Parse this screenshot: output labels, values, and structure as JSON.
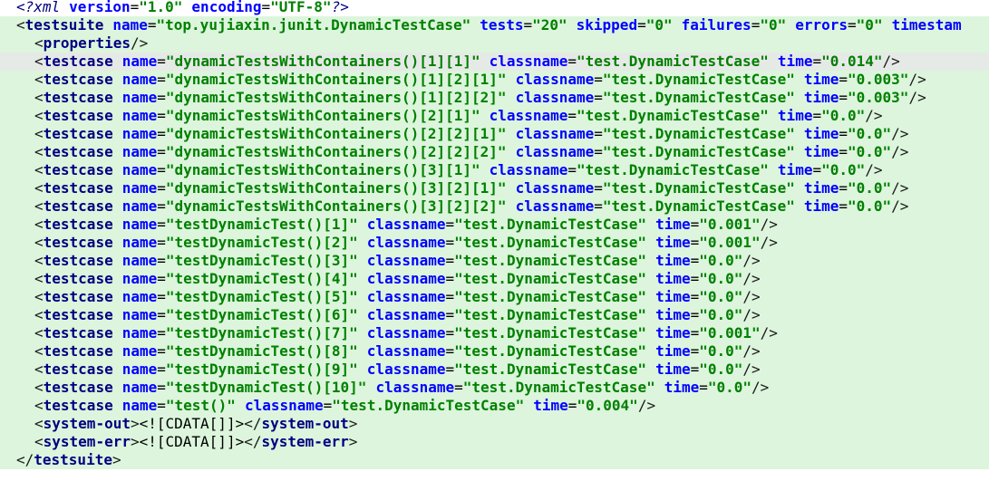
{
  "prolog": {
    "target": "xml",
    "version_attr": "version",
    "version_val": "\"1.0\"",
    "encoding_attr": "encoding",
    "encoding_val": "\"UTF-8\""
  },
  "suite": {
    "tag": "testsuite",
    "attrs": [
      {
        "name": "name",
        "value": "\"top.yujiaxin.junit.DynamicTestCase\""
      },
      {
        "name": "tests",
        "value": "\"20\""
      },
      {
        "name": "skipped",
        "value": "\"0\""
      },
      {
        "name": "failures",
        "value": "\"0\""
      },
      {
        "name": "errors",
        "value": "\"0\""
      },
      {
        "name": "timestam",
        "value": ""
      }
    ]
  },
  "properties_tag": "properties",
  "testcase_tag": "testcase",
  "attr_labels": {
    "name": "name",
    "classname": "classname",
    "time": "time"
  },
  "testcases": [
    {
      "name": "\"dynamicTestsWithContainers()[1][1]\"",
      "classname": "\"test.DynamicTestCase\"",
      "time": "\"0.014\""
    },
    {
      "name": "\"dynamicTestsWithContainers()[1][2][1]\"",
      "classname": "\"test.DynamicTestCase\"",
      "time": "\"0.003\""
    },
    {
      "name": "\"dynamicTestsWithContainers()[1][2][2]\"",
      "classname": "\"test.DynamicTestCase\"",
      "time": "\"0.003\""
    },
    {
      "name": "\"dynamicTestsWithContainers()[2][1]\"",
      "classname": "\"test.DynamicTestCase\"",
      "time": "\"0.0\""
    },
    {
      "name": "\"dynamicTestsWithContainers()[2][2][1]\"",
      "classname": "\"test.DynamicTestCase\"",
      "time": "\"0.0\""
    },
    {
      "name": "\"dynamicTestsWithContainers()[2][2][2]\"",
      "classname": "\"test.DynamicTestCase\"",
      "time": "\"0.0\""
    },
    {
      "name": "\"dynamicTestsWithContainers()[3][1]\"",
      "classname": "\"test.DynamicTestCase\"",
      "time": "\"0.0\""
    },
    {
      "name": "\"dynamicTestsWithContainers()[3][2][1]\"",
      "classname": "\"test.DynamicTestCase\"",
      "time": "\"0.0\""
    },
    {
      "name": "\"dynamicTestsWithContainers()[3][2][2]\"",
      "classname": "\"test.DynamicTestCase\"",
      "time": "\"0.0\""
    },
    {
      "name": "\"testDynamicTest()[1]\"",
      "classname": "\"test.DynamicTestCase\"",
      "time": "\"0.001\""
    },
    {
      "name": "\"testDynamicTest()[2]\"",
      "classname": "\"test.DynamicTestCase\"",
      "time": "\"0.001\""
    },
    {
      "name": "\"testDynamicTest()[3]\"",
      "classname": "\"test.DynamicTestCase\"",
      "time": "\"0.0\""
    },
    {
      "name": "\"testDynamicTest()[4]\"",
      "classname": "\"test.DynamicTestCase\"",
      "time": "\"0.0\""
    },
    {
      "name": "\"testDynamicTest()[5]\"",
      "classname": "\"test.DynamicTestCase\"",
      "time": "\"0.0\""
    },
    {
      "name": "\"testDynamicTest()[6]\"",
      "classname": "\"test.DynamicTestCase\"",
      "time": "\"0.0\""
    },
    {
      "name": "\"testDynamicTest()[7]\"",
      "classname": "\"test.DynamicTestCase\"",
      "time": "\"0.001\""
    },
    {
      "name": "\"testDynamicTest()[8]\"",
      "classname": "\"test.DynamicTestCase\"",
      "time": "\"0.0\""
    },
    {
      "name": "\"testDynamicTest()[9]\"",
      "classname": "\"test.DynamicTestCase\"",
      "time": "\"0.0\""
    },
    {
      "name": "\"testDynamicTest()[10]\"",
      "classname": "\"test.DynamicTestCase\"",
      "time": "\"0.0\""
    },
    {
      "name": "\"test()\"",
      "classname": "\"test.DynamicTestCase\"",
      "time": "\"0.004\""
    }
  ],
  "system_out_tag": "system-out",
  "system_err_tag": "system-err",
  "cdata_text": "<![CDATA[]]>",
  "colors": {
    "background_highlight": "#dcf5dc",
    "current_line": "#e6eae6",
    "tag": "#000080",
    "attribute": "#0000ff",
    "value": "#008000"
  }
}
